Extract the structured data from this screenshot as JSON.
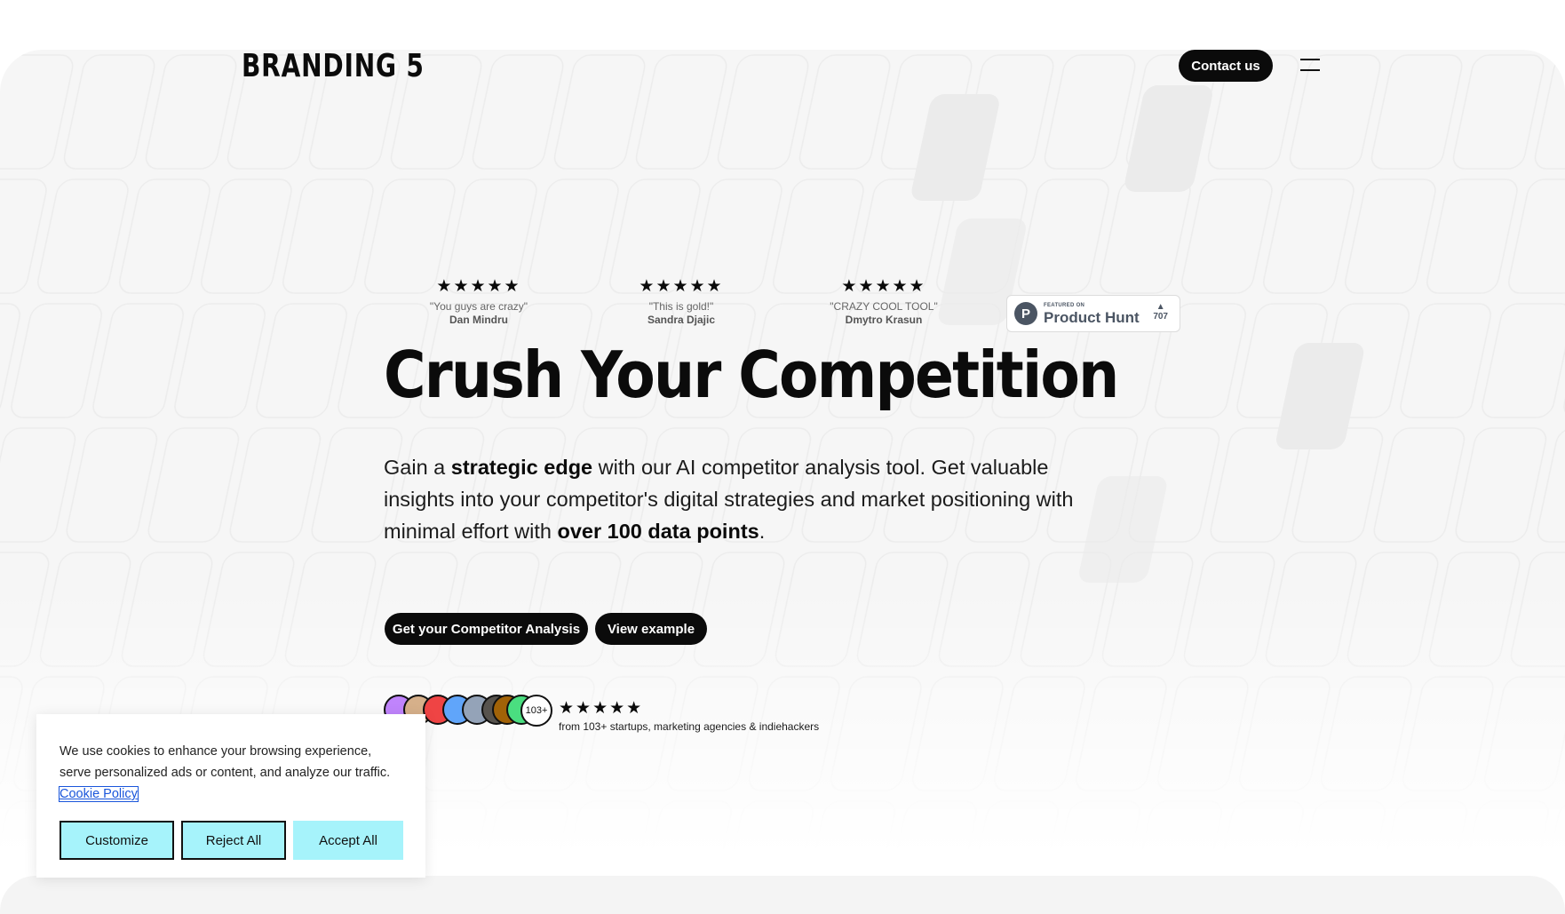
{
  "header": {
    "logo": "BRANDING 5",
    "contact_label": "Contact us"
  },
  "testimonials": [
    {
      "stars": "★★★★★",
      "quote": "\"You guys are crazy\"",
      "author": "Dan Mindru"
    },
    {
      "stars": "★★★★★",
      "quote": "\"This is gold!\"",
      "author": "Sandra Djajic"
    },
    {
      "stars": "★★★★★",
      "quote": "\"CRAZY COOL TOOL\"",
      "author": "Dmytro Krasun"
    }
  ],
  "product_hunt": {
    "featured": "FEATURED ON",
    "name": "Product Hunt",
    "letter": "P",
    "arrow": "▲",
    "votes": "707"
  },
  "hero": {
    "headline": "Crush Your Competition",
    "lead": {
      "part1": "Gain a ",
      "bold1": "strategic edge",
      "part2": " with our AI competitor analysis tool. Get valuable insights into your competitor's digital strategies and market positioning with minimal effort with ",
      "bold2": "over 100 data points",
      "part3": "."
    },
    "cta_primary": "Get your Competitor Analysis",
    "cta_secondary": "View example"
  },
  "social_proof": {
    "more_count": "103+",
    "stars": "★★★★★",
    "text": "from 103+ startups, marketing agencies & indiehackers",
    "avatar_colors": [
      "#c084fc",
      "#d6b08a",
      "#ef4444",
      "#60a5fa",
      "#94a3b8",
      "#57534e",
      "#a16207",
      "#4ade80"
    ]
  },
  "cookie": {
    "text": "We use cookies to enhance your browsing experience, serve personalized ads or content, and analyze our traffic. ",
    "link": "Cookie Policy",
    "customize": "Customize",
    "reject": "Reject All",
    "accept": "Accept All"
  }
}
